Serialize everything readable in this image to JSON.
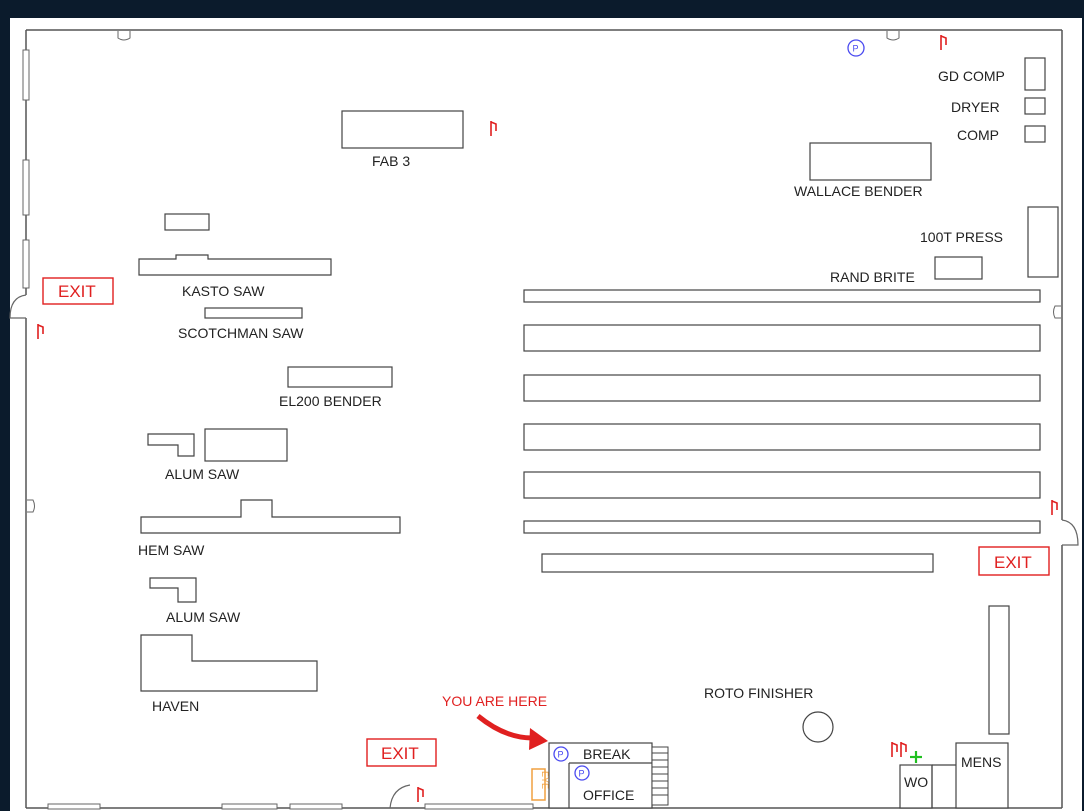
{
  "labels": {
    "gd_comp": "GD COMP",
    "dryer": "DRYER",
    "comp": "COMP",
    "fab3": "FAB 3",
    "wallace_bender": "WALLACE BENDER",
    "press_100t": "100T PRESS",
    "rand_brite": "RAND BRITE",
    "kasto_saw": "KASTO SAW",
    "scotchman_saw": "SCOTCHMAN SAW",
    "el200_bender": "EL200 BENDER",
    "alum_saw_1": "ALUM SAW",
    "hem_saw": "HEM SAW",
    "alum_saw_2": "ALUM SAW",
    "haven": "HAVEN",
    "roto_finisher": "ROTO FINISHER",
    "break": "BREAK",
    "office": "OFFICE",
    "mens": "MENS",
    "wo": "WO",
    "you_are_here": "YOU ARE HERE",
    "eye": "EYE"
  },
  "exits": {
    "left": "EXIT",
    "right": "EXIT",
    "bottom": "EXIT"
  },
  "parking_marker": "P",
  "colors": {
    "background": "#0b1b2c",
    "paper": "#ffffff",
    "exit_red": "#e02020",
    "marker_blue": "#4a4af0",
    "eye_orange": "#f0a040",
    "first_aid_green": "#20c020"
  },
  "icons": [
    "fire-extinguisher-icon",
    "parking-marker-icon",
    "first-aid-cross-icon",
    "eyewash-station-icon",
    "you-are-here-arrow-icon"
  ]
}
